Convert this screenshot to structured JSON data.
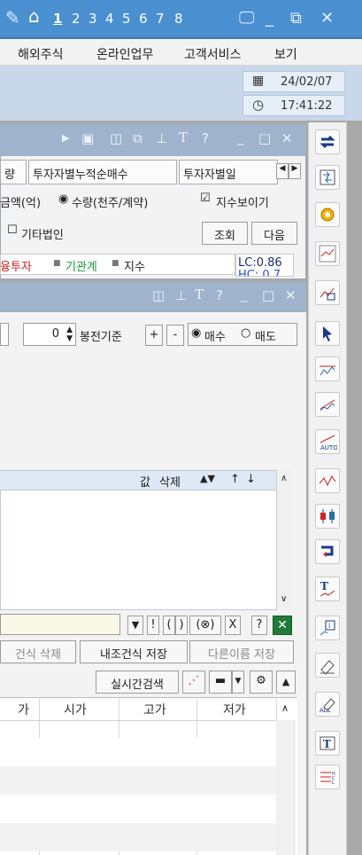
{
  "titlebar": {
    "numbers": [
      "1",
      "2",
      "3",
      "4",
      "5",
      "6",
      "7",
      "8"
    ]
  },
  "menu": {
    "items": [
      "해외주식",
      "온라인업무",
      "고객서비스",
      "보기"
    ]
  },
  "info": {
    "date": "24/02/07",
    "time": "17:41:22"
  },
  "window1": {
    "tabs": [
      "량",
      "투자자별누적순매수",
      "투자자별일"
    ],
    "radio_amount": "금액(억)",
    "radio_qty": "수량(천주/계약)",
    "check_index": "지수보이기",
    "check_other": "기타법인",
    "btn_query": "조회",
    "btn_next": "다음",
    "legend": {
      "invest": "융투자",
      "inst": "기관계",
      "index": "지수"
    },
    "lc_value": "LC:0.86",
    "hc_value": "HC: 0.7"
  },
  "window2": {
    "spin_value": "0",
    "base_label": "봉전기준",
    "plus": "+",
    "minus": "-",
    "buy": "매수",
    "sell": "매도",
    "cond_header": {
      "value": "값",
      "delete": "삭제",
      "down_up": "▲▼",
      "up": "↑",
      "down": "↓"
    },
    "formula_ops": [
      "▼",
      "!",
      "(",
      ")",
      "(⊗)",
      "X",
      "?"
    ],
    "btn_cond_delete": "건식 삭제",
    "btn_my_save": "내조건식 저장",
    "btn_save_as": "다른이름 저장",
    "btn_realtime": "실시간검색",
    "grid_headers": [
      "가",
      "시가",
      "고가",
      "저가"
    ]
  },
  "colors": {
    "titlebar": "#4a8fd0",
    "window_title": "#9fb3cc",
    "accent_red": "#cc2222",
    "accent_green": "#1a9a3a"
  }
}
